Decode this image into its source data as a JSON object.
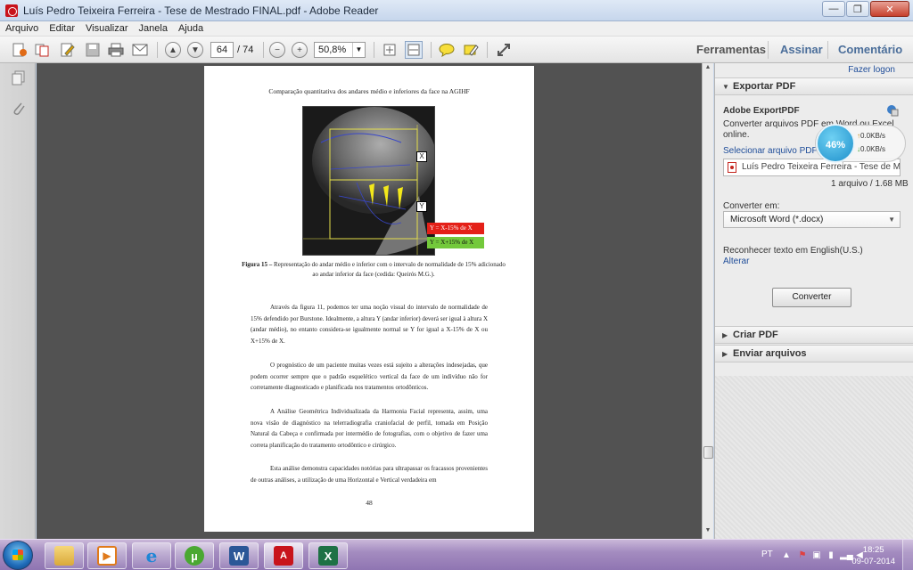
{
  "window": {
    "title": "Luís Pedro Teixeira Ferreira - Tese de Mestrado FINAL.pdf - Adobe Reader",
    "minimize": "—",
    "maximize": "❐",
    "close": "✕"
  },
  "menu": [
    "Arquivo",
    "Editar",
    "Visualizar",
    "Janela",
    "Ajuda"
  ],
  "toolbar": {
    "page_current": "64",
    "page_total": "/ 74",
    "zoom": "50,8%",
    "tabs": [
      "Ferramentas",
      "Assinar",
      "Comentário"
    ]
  },
  "document": {
    "header": "Comparação quantitativa dos andares médio e inferiores da face na AGIHF",
    "figure": {
      "label_x": "X",
      "label_y": "Y",
      "box_red": "Y = X-15% de X",
      "box_green": "Y = X+15% de X"
    },
    "caption_bold": "Figura 15 –",
    "caption_text": " Representação do andar médio e inferior com o intervalo de normalidade de 15% adicionado ao andar inferior da face (cedida: Queirós M.G.).",
    "paragraphs": [
      "Através da figura 11, podemos ter uma noção visual do intervalo de normalidade de 15% defendido por Burstone. Idealmente, a altura Y (andar inferior) deverá ser igual à altura X (andar médio), no entanto considera-se igualmente normal se Y for igual a X-15% de X ou X+15% de X.",
      "O prognóstico de um paciente muitas vezes está sujeito a alterações indesejadas, que podem ocorrer sempre que o padrão esquelético vertical da face de um indivíduo não for corretamente diagnosticado e planificada nos tratamentos ortodônticos.",
      "A Análise Geométrica Individualizada da Harmonia Facial representa, assim, uma nova visão de diagnóstico na telerradiografia craniofacial de perfil, tomada em Posição Natural da Cabeça e confirmada por intermédio de fotografias, com o objetivo de fazer uma correta planificação do tratamento ortodôntico e cirúrgico.",
      "Esta análise demonstra capacidades notórias para ultrapassar os fracassos provenientes de outras análises, a utilização de uma Horizontal e Vertical verdadeira em"
    ],
    "page_number": "48"
  },
  "right_panel": {
    "login": "Fazer logon",
    "export_head": "Exportar PDF",
    "service_title": "Adobe ExportPDF",
    "service_desc_1": "Converter arquivos PDF em Word ou Excel",
    "service_desc_2": "online.",
    "select_label": "Selecionar arquivo PDF:",
    "file_name": "Luís Pedro Teixeira Ferreira - Tese de Mestrado FINAL.pdf",
    "file_info": "1 arquivo / 1.68 MB",
    "convert_label": "Converter em:",
    "convert_option": "Microsoft Word (*.docx)",
    "ocr_text": "Reconhecer texto em English(U.S.)",
    "ocr_link": "Alterar",
    "convert_button": "Converter",
    "create_head": "Criar PDF",
    "send_head": "Enviar arquivos"
  },
  "speed_widget": {
    "percent": "46%",
    "up": "0.0KB/s",
    "down": "0.0KB/s"
  },
  "taskbar": {
    "lang": "PT",
    "time": "18:25",
    "date": "09-07-2014"
  }
}
